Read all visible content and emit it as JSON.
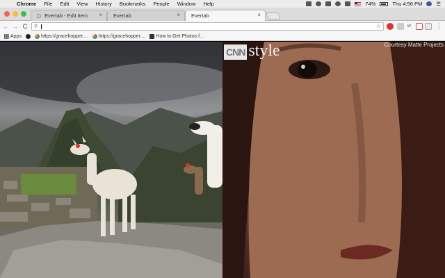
{
  "menubar": {
    "app_name": "Chrome",
    "items": [
      "File",
      "Edit",
      "View",
      "History",
      "Bookmarks",
      "People",
      "Window",
      "Help"
    ],
    "battery": "74%",
    "clock": "Thu 4:56 PM"
  },
  "tabs": [
    {
      "title": "Evertab - Edit Item",
      "close": "×"
    },
    {
      "title": "Evertab",
      "close": "×"
    },
    {
      "title": "Evertab",
      "close": "×"
    }
  ],
  "toolbar": {
    "back": "←",
    "forward": "→",
    "reload": "C",
    "address_value": "",
    "star": "☆",
    "ext_w": "W.",
    "menu": "⋮"
  },
  "bookmarks": [
    {
      "label": "Apps",
      "icon": "apps-grid-icon"
    },
    {
      "label": "",
      "icon": "github-icon"
    },
    {
      "label": "https://gracehopper....",
      "icon": "pinwheel-icon"
    },
    {
      "label": "https://gracehopper....",
      "icon": "pinwheel-icon"
    },
    {
      "label": "How to Get Photos f...",
      "icon": "hm-icon"
    }
  ],
  "content": {
    "right_panel": {
      "logo_cnn": "CNN",
      "logo_style": "style",
      "credit": "Courtesy Matte Projects"
    }
  },
  "colors": {
    "close": "#fc5f57",
    "minimize": "#fdbc2e",
    "maximize": "#33c748"
  }
}
